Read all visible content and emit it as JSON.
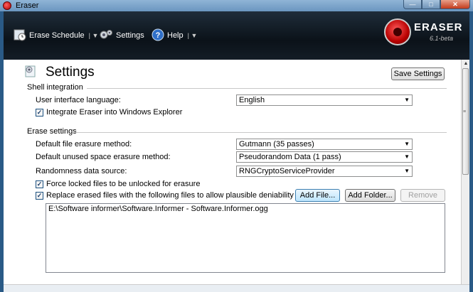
{
  "window": {
    "title": "Eraser"
  },
  "toolbar": {
    "erase_schedule": "Erase Schedule",
    "settings": "Settings",
    "help": "Help",
    "logo_name": "ERASER",
    "logo_version": "6.1-beta"
  },
  "page": {
    "title": "Settings",
    "save_button": "Save Settings"
  },
  "shell": {
    "group_label": "Shell integration",
    "language_label": "User interface language:",
    "language_value": "English",
    "integrate_label": "Integrate Eraser into Windows Explorer",
    "integrate_checked": true
  },
  "erase": {
    "group_label": "Erase settings",
    "file_method_label": "Default file erasure method:",
    "file_method_value": "Gutmann (35 passes)",
    "unused_method_label": "Default unused space erasure method:",
    "unused_method_value": "Pseudorandom Data (1 pass)",
    "random_label": "Randomness data source:",
    "random_value": "RNGCryptoServiceProvider",
    "force_locked_label": "Force locked files to be unlocked for erasure",
    "force_locked_checked": true,
    "replace_label": "Replace erased files with the following files to allow plausible deniability",
    "replace_checked": true,
    "add_file": "Add File...",
    "add_folder": "Add Folder...",
    "remove": "Remove",
    "files": [
      "E:\\Software informer\\Software.Informer - Software.Informer.ogg"
    ]
  },
  "colors": {
    "toolbar_bg": "#0b1219",
    "accent": "#3c7fb1"
  }
}
